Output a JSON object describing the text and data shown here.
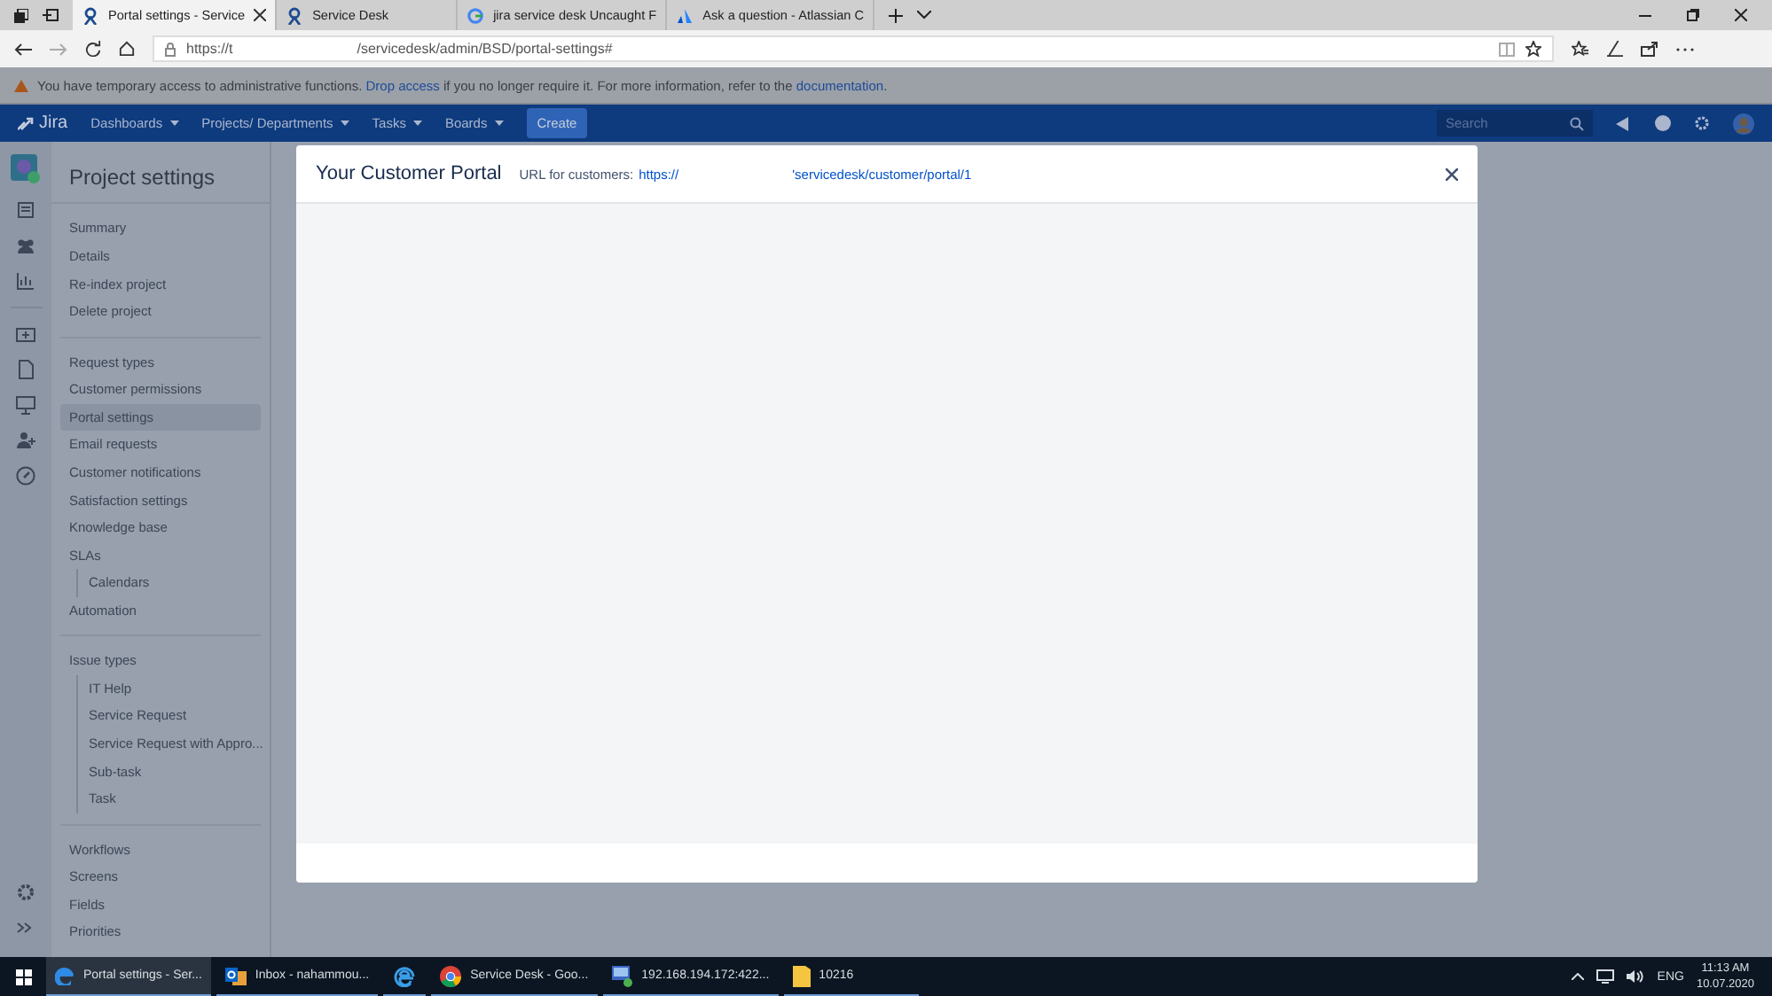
{
  "browser": {
    "tabs": [
      {
        "title": "Portal settings - Service",
        "kind": "jira",
        "selected": true
      },
      {
        "title": "Service Desk",
        "kind": "jira",
        "selected": false
      },
      {
        "title": "jira service desk Uncaught F",
        "kind": "google",
        "selected": false
      },
      {
        "title": "Ask a question - Atlassian C",
        "kind": "atlassian",
        "selected": false
      }
    ],
    "url_start": "https://t",
    "url_end": "/servicedesk/admin/BSD/portal-settings#"
  },
  "banner": {
    "segments": [
      {
        "text": "You have temporary access to administrative functions. ",
        "kind": "text"
      },
      {
        "text": "Drop access",
        "kind": "link"
      },
      {
        "text": " if you no longer require it. For more information, refer to the ",
        "kind": "text"
      },
      {
        "text": "documentation",
        "kind": "link"
      },
      {
        "text": ".",
        "kind": "text"
      }
    ]
  },
  "nav": {
    "logo": "Jira",
    "menus": [
      "Dashboards",
      "Projects/ Departments",
      "Tasks",
      "Boards"
    ],
    "create": "Create",
    "search_placeholder": "Search"
  },
  "sidebar": {
    "title": "Project settings",
    "groups": [
      [
        {
          "label": "Summary",
          "selected": false
        },
        {
          "label": "Details",
          "selected": false
        },
        {
          "label": "Re-index project",
          "selected": false
        },
        {
          "label": "Delete project",
          "selected": false
        }
      ],
      [
        {
          "label": "Request types",
          "selected": false
        },
        {
          "label": "Customer permissions",
          "selected": false
        },
        {
          "label": "Portal settings",
          "selected": true
        },
        {
          "label": "Email requests",
          "selected": false
        },
        {
          "label": "Customer notifications",
          "selected": false
        },
        {
          "label": "Satisfaction settings",
          "selected": false
        },
        {
          "label": "Knowledge base",
          "selected": false
        },
        {
          "label": "SLAs",
          "selected": false,
          "children": [
            {
              "label": "Calendars",
              "selected": false
            }
          ]
        },
        {
          "label": "Automation",
          "selected": false
        }
      ],
      [
        {
          "label": "Issue types",
          "selected": false,
          "children": [
            {
              "label": "IT Help",
              "selected": false
            },
            {
              "label": "Service Request",
              "selected": false
            },
            {
              "label": "Service Request with Appro...",
              "selected": false
            },
            {
              "label": "Sub-task",
              "selected": false
            },
            {
              "label": "Task",
              "selected": false
            }
          ]
        }
      ],
      [
        {
          "label": "Workflows",
          "selected": false
        },
        {
          "label": "Screens",
          "selected": false
        },
        {
          "label": "Fields",
          "selected": false
        },
        {
          "label": "Priorities",
          "selected": false
        }
      ]
    ]
  },
  "modal": {
    "title": "Your Customer Portal",
    "url_label": "URL for customers:",
    "url_start": "https://",
    "url_end": "'servicedesk/customer/portal/1"
  },
  "taskbar": {
    "items": [
      {
        "label": "Portal settings - Ser...",
        "kind": "edge",
        "selected": true
      },
      {
        "label": "Inbox - nahammou...",
        "kind": "outlook",
        "selected": false
      },
      {
        "kind": "ie",
        "selected": false
      },
      {
        "label": "Service Desk - Goo...",
        "kind": "chrome",
        "selected": false
      },
      {
        "label": "192.168.194.172:422...",
        "kind": "remote",
        "selected": false
      },
      {
        "label": "10216",
        "kind": "folder",
        "selected": false
      }
    ],
    "lang": "ENG",
    "time": "11:13 AM",
    "date": "10.07.2020"
  }
}
